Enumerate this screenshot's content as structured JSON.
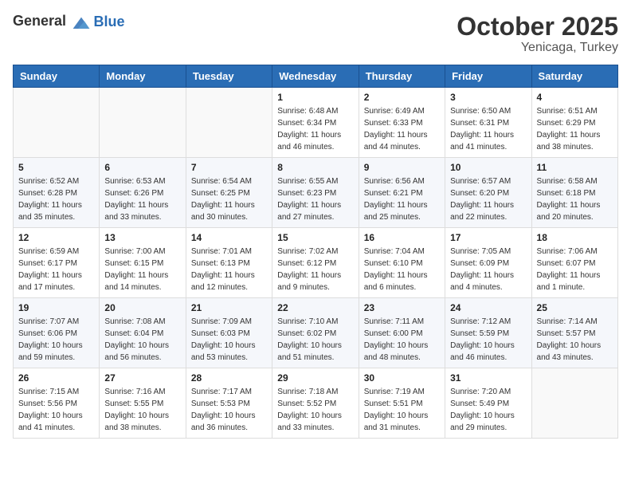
{
  "header": {
    "logo_general": "General",
    "logo_blue": "Blue",
    "month": "October 2025",
    "location": "Yenicaga, Turkey"
  },
  "weekdays": [
    "Sunday",
    "Monday",
    "Tuesday",
    "Wednesday",
    "Thursday",
    "Friday",
    "Saturday"
  ],
  "weeks": [
    [
      {
        "day": "",
        "info": ""
      },
      {
        "day": "",
        "info": ""
      },
      {
        "day": "",
        "info": ""
      },
      {
        "day": "1",
        "info": "Sunrise: 6:48 AM\nSunset: 6:34 PM\nDaylight: 11 hours\nand 46 minutes."
      },
      {
        "day": "2",
        "info": "Sunrise: 6:49 AM\nSunset: 6:33 PM\nDaylight: 11 hours\nand 44 minutes."
      },
      {
        "day": "3",
        "info": "Sunrise: 6:50 AM\nSunset: 6:31 PM\nDaylight: 11 hours\nand 41 minutes."
      },
      {
        "day": "4",
        "info": "Sunrise: 6:51 AM\nSunset: 6:29 PM\nDaylight: 11 hours\nand 38 minutes."
      }
    ],
    [
      {
        "day": "5",
        "info": "Sunrise: 6:52 AM\nSunset: 6:28 PM\nDaylight: 11 hours\nand 35 minutes."
      },
      {
        "day": "6",
        "info": "Sunrise: 6:53 AM\nSunset: 6:26 PM\nDaylight: 11 hours\nand 33 minutes."
      },
      {
        "day": "7",
        "info": "Sunrise: 6:54 AM\nSunset: 6:25 PM\nDaylight: 11 hours\nand 30 minutes."
      },
      {
        "day": "8",
        "info": "Sunrise: 6:55 AM\nSunset: 6:23 PM\nDaylight: 11 hours\nand 27 minutes."
      },
      {
        "day": "9",
        "info": "Sunrise: 6:56 AM\nSunset: 6:21 PM\nDaylight: 11 hours\nand 25 minutes."
      },
      {
        "day": "10",
        "info": "Sunrise: 6:57 AM\nSunset: 6:20 PM\nDaylight: 11 hours\nand 22 minutes."
      },
      {
        "day": "11",
        "info": "Sunrise: 6:58 AM\nSunset: 6:18 PM\nDaylight: 11 hours\nand 20 minutes."
      }
    ],
    [
      {
        "day": "12",
        "info": "Sunrise: 6:59 AM\nSunset: 6:17 PM\nDaylight: 11 hours\nand 17 minutes."
      },
      {
        "day": "13",
        "info": "Sunrise: 7:00 AM\nSunset: 6:15 PM\nDaylight: 11 hours\nand 14 minutes."
      },
      {
        "day": "14",
        "info": "Sunrise: 7:01 AM\nSunset: 6:13 PM\nDaylight: 11 hours\nand 12 minutes."
      },
      {
        "day": "15",
        "info": "Sunrise: 7:02 AM\nSunset: 6:12 PM\nDaylight: 11 hours\nand 9 minutes."
      },
      {
        "day": "16",
        "info": "Sunrise: 7:04 AM\nSunset: 6:10 PM\nDaylight: 11 hours\nand 6 minutes."
      },
      {
        "day": "17",
        "info": "Sunrise: 7:05 AM\nSunset: 6:09 PM\nDaylight: 11 hours\nand 4 minutes."
      },
      {
        "day": "18",
        "info": "Sunrise: 7:06 AM\nSunset: 6:07 PM\nDaylight: 11 hours\nand 1 minute."
      }
    ],
    [
      {
        "day": "19",
        "info": "Sunrise: 7:07 AM\nSunset: 6:06 PM\nDaylight: 10 hours\nand 59 minutes."
      },
      {
        "day": "20",
        "info": "Sunrise: 7:08 AM\nSunset: 6:04 PM\nDaylight: 10 hours\nand 56 minutes."
      },
      {
        "day": "21",
        "info": "Sunrise: 7:09 AM\nSunset: 6:03 PM\nDaylight: 10 hours\nand 53 minutes."
      },
      {
        "day": "22",
        "info": "Sunrise: 7:10 AM\nSunset: 6:02 PM\nDaylight: 10 hours\nand 51 minutes."
      },
      {
        "day": "23",
        "info": "Sunrise: 7:11 AM\nSunset: 6:00 PM\nDaylight: 10 hours\nand 48 minutes."
      },
      {
        "day": "24",
        "info": "Sunrise: 7:12 AM\nSunset: 5:59 PM\nDaylight: 10 hours\nand 46 minutes."
      },
      {
        "day": "25",
        "info": "Sunrise: 7:14 AM\nSunset: 5:57 PM\nDaylight: 10 hours\nand 43 minutes."
      }
    ],
    [
      {
        "day": "26",
        "info": "Sunrise: 7:15 AM\nSunset: 5:56 PM\nDaylight: 10 hours\nand 41 minutes."
      },
      {
        "day": "27",
        "info": "Sunrise: 7:16 AM\nSunset: 5:55 PM\nDaylight: 10 hours\nand 38 minutes."
      },
      {
        "day": "28",
        "info": "Sunrise: 7:17 AM\nSunset: 5:53 PM\nDaylight: 10 hours\nand 36 minutes."
      },
      {
        "day": "29",
        "info": "Sunrise: 7:18 AM\nSunset: 5:52 PM\nDaylight: 10 hours\nand 33 minutes."
      },
      {
        "day": "30",
        "info": "Sunrise: 7:19 AM\nSunset: 5:51 PM\nDaylight: 10 hours\nand 31 minutes."
      },
      {
        "day": "31",
        "info": "Sunrise: 7:20 AM\nSunset: 5:49 PM\nDaylight: 10 hours\nand 29 minutes."
      },
      {
        "day": "",
        "info": ""
      }
    ]
  ]
}
